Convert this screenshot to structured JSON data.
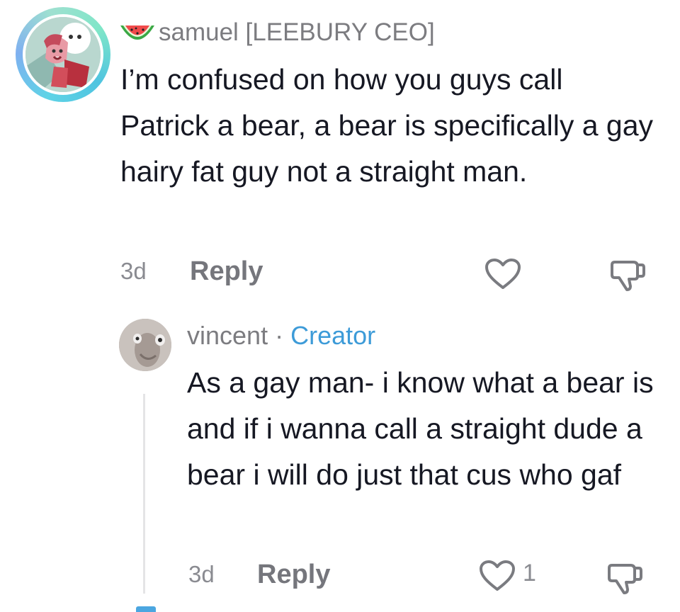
{
  "comment": {
    "username": "samuel [LEEBURY CEO]",
    "emoji": "watermelon-icon",
    "text": "I’m confused on how you guys call Patrick a bear, a bear is specifically a gay hairy fat guy not a straight man.",
    "time": "3d",
    "reply_label": "Reply",
    "avatar_ring_colors": [
      "#5fd3e6",
      "#7fe6c8"
    ]
  },
  "reply": {
    "username": "vincent",
    "separator": "·",
    "badge": "Creator",
    "badge_color": "#3d9bd8",
    "text": "As a gay man- i know what a bear is and if i wanna call a straight dude a bear i will do just that cus who gaf",
    "time": "3d",
    "reply_label": "Reply",
    "like_count": "1"
  },
  "icons": {
    "like": "heart-outline-icon",
    "dislike": "thumbs-down-outline-icon"
  }
}
